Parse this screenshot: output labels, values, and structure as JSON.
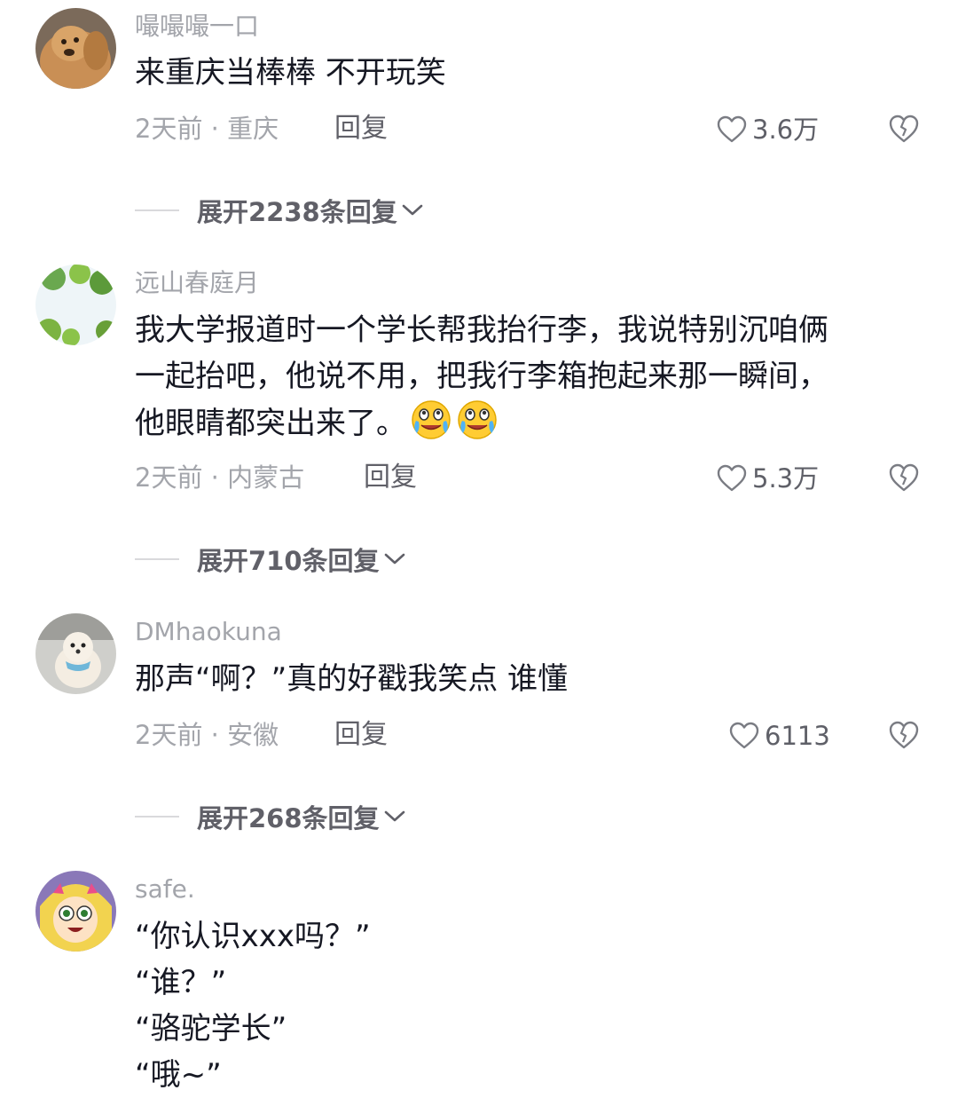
{
  "comments": [
    {
      "username": "嘬嘬嘬一口",
      "lines": [
        "来重庆当棒棒 不开玩笑"
      ],
      "meta": "2天前 · 重庆",
      "reply_label": "回复",
      "likes": "3.6万",
      "expand_label": "展开2238条回复"
    },
    {
      "username": "远山春庭月",
      "lines": [
        "我大学报道时一个学长帮我抬行李，我说特别沉咱俩",
        "一起抬吧，他说不用，把我行李箱抱起来那一瞬间，",
        "他眼睛都突出来了。"
      ],
      "meta": "2天前 · 内蒙古",
      "reply_label": "回复",
      "likes": "5.3万",
      "expand_label": "展开710条回复"
    },
    {
      "username": "DMhaokuna",
      "lines": [
        "那声“啊？”真的好戳我笑点 谁懂"
      ],
      "meta": "2天前 · 安徽",
      "reply_label": "回复",
      "likes": "6113",
      "expand_label": "展开268条回复"
    },
    {
      "username": "safe.",
      "lines": [
        "“你认识xxx吗？”",
        "“谁？”",
        "“骆驼学长”",
        "“哦~”"
      ]
    }
  ],
  "icons": {
    "like": "heart-outline-icon",
    "dislike": "broken-heart-icon",
    "expand": "chevron-down-icon",
    "emoji": "laugh-cry-emoji-icon"
  },
  "colors": {
    "text": "#161823",
    "muted": "#a3a5ab",
    "secondary": "#606068"
  }
}
